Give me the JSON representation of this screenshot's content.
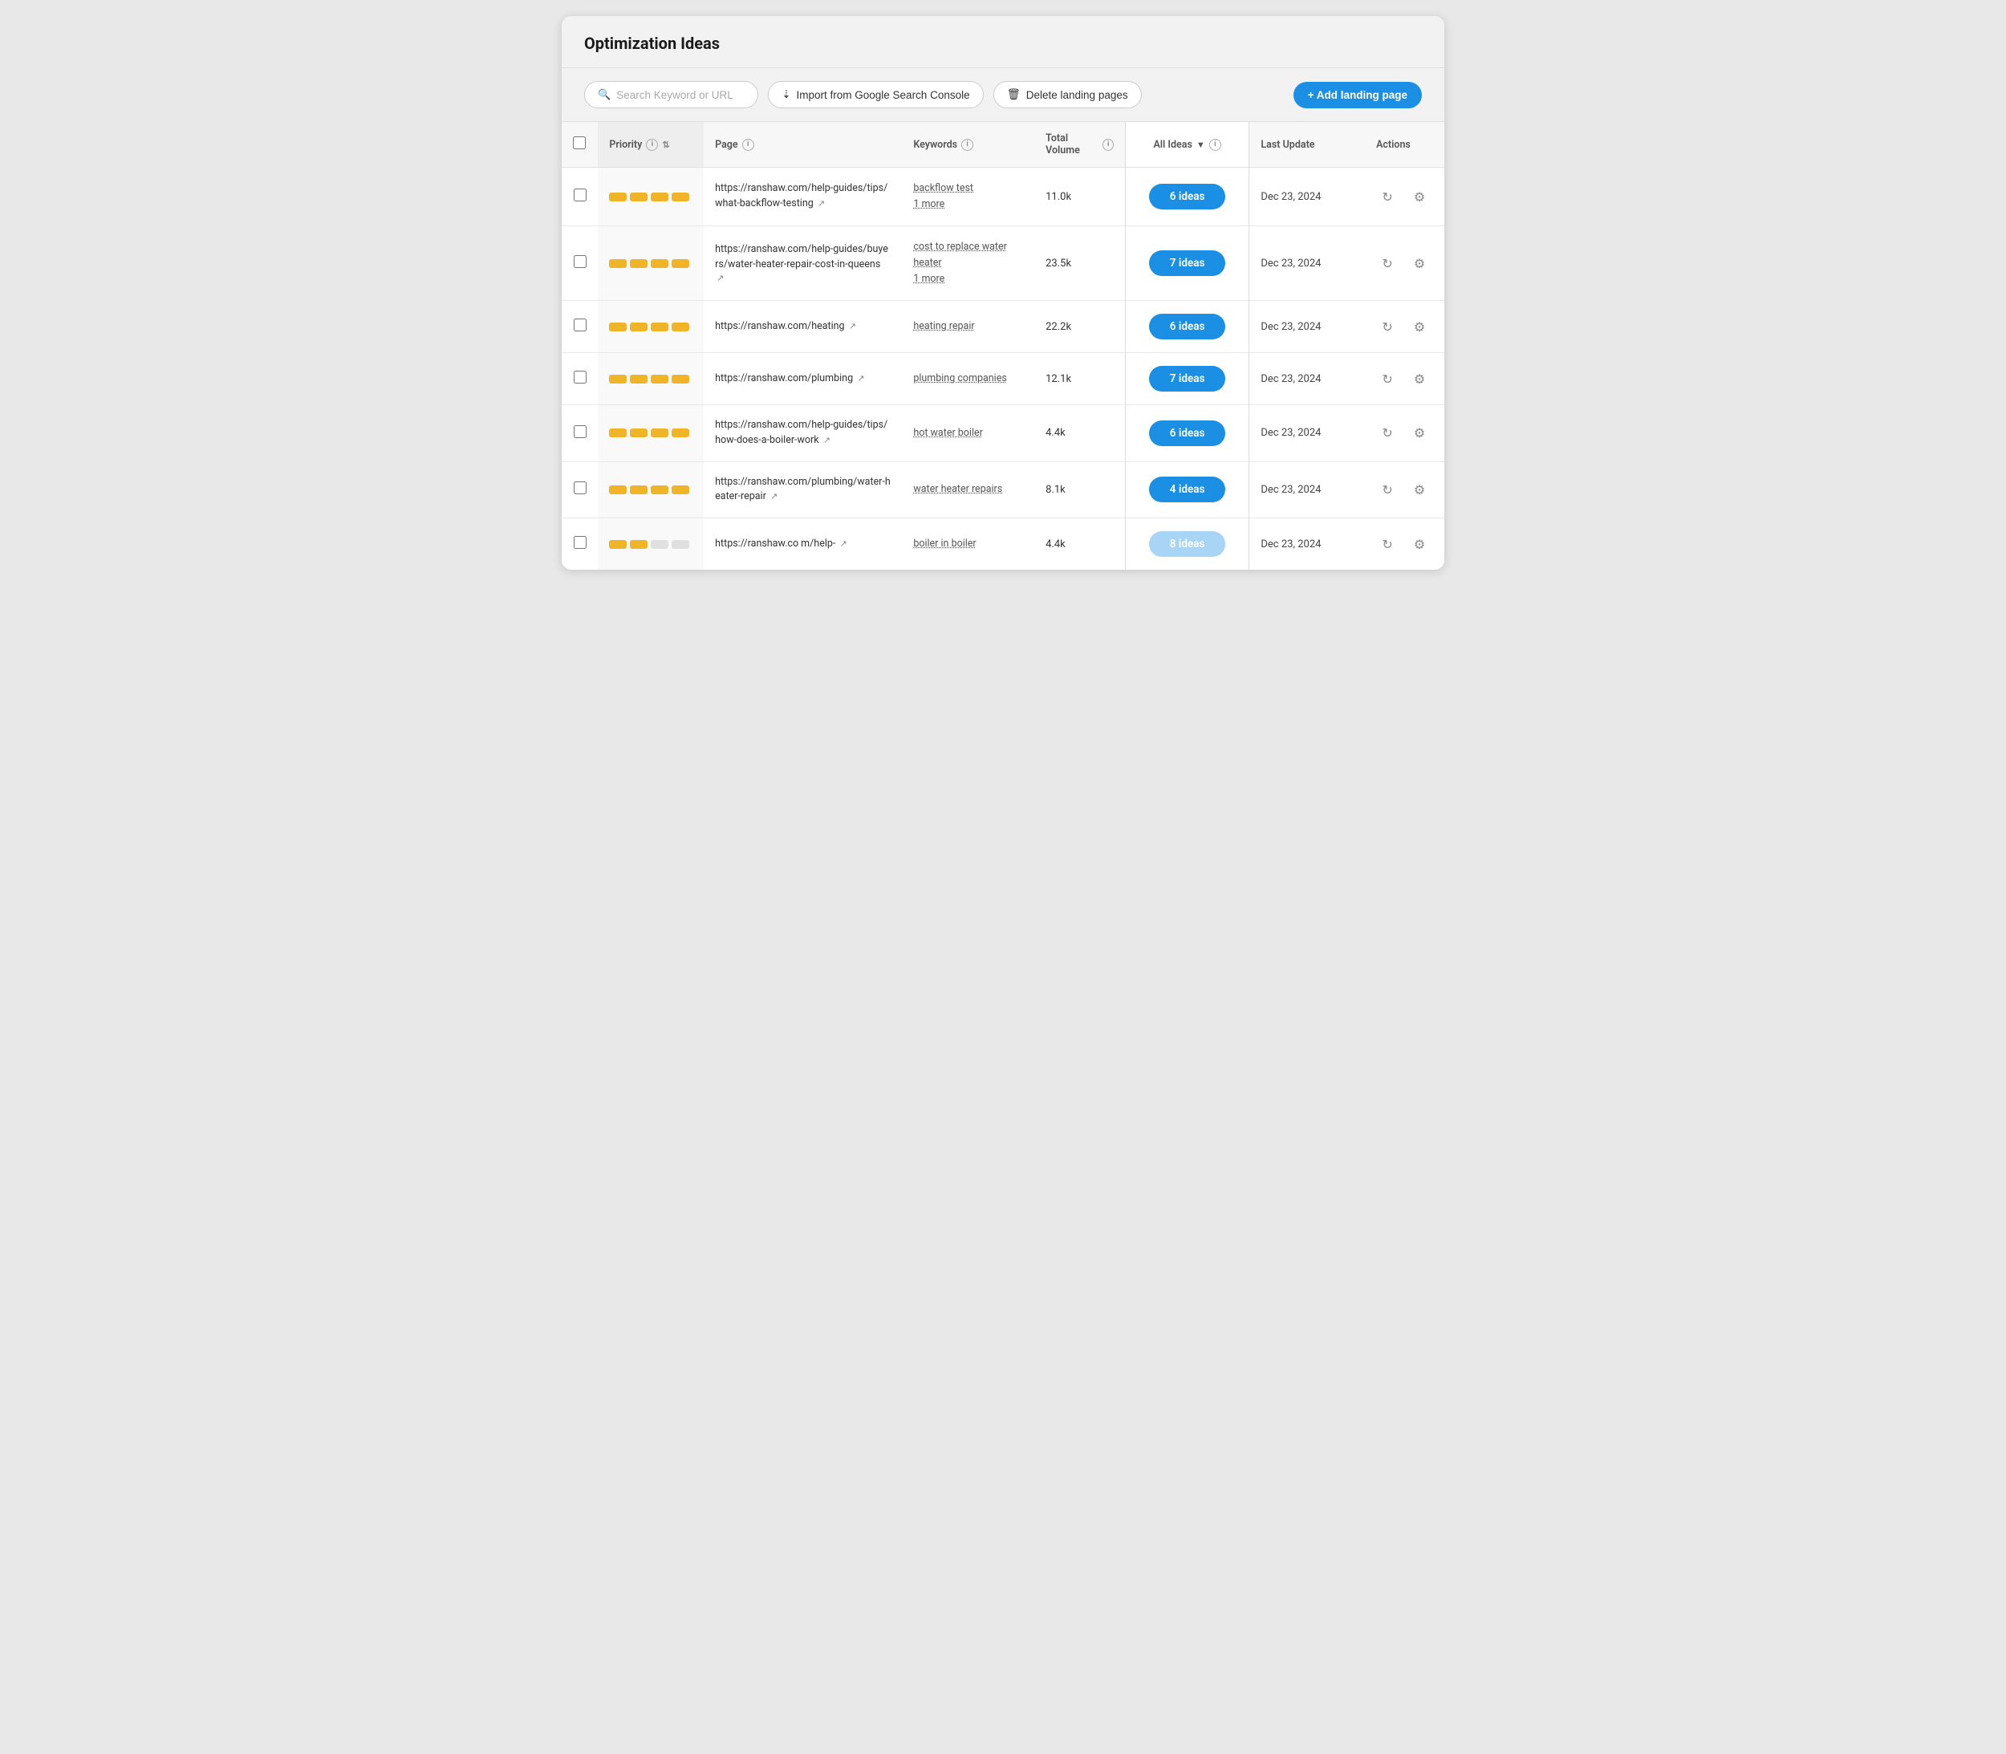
{
  "header": {
    "title": "Optimization Ideas"
  },
  "toolbar": {
    "search_placeholder": "Search Keyword or URL",
    "import_label": "Import from Google Search Console",
    "delete_label": "Delete landing pages",
    "add_label": "+ Add landing page"
  },
  "table": {
    "columns": {
      "priority": "Priority",
      "page": "Page",
      "keywords": "Keywords",
      "total_volume": "Total Volume",
      "all_ideas": "All Ideas",
      "last_update": "Last Update",
      "actions": "Actions"
    },
    "rows": [
      {
        "priority_bars": 4,
        "page_url": "https://ranshaw.com/help-guides/tips/what-backflow-testing",
        "keywords": [
          "backflow test",
          "1 more"
        ],
        "volume": "11.0k",
        "ideas": "6 ideas",
        "ideas_faded": false,
        "last_update": "Dec 23, 2024"
      },
      {
        "priority_bars": 4,
        "page_url": "https://ranshaw.com/help-guides/buyers/water-heater-repair-cost-in-queens",
        "keywords": [
          "cost to replace water heater",
          "1 more"
        ],
        "volume": "23.5k",
        "ideas": "7 ideas",
        "ideas_faded": false,
        "last_update": "Dec 23, 2024"
      },
      {
        "priority_bars": 4,
        "page_url": "https://ranshaw.com/heating",
        "keywords": [
          "heating repair"
        ],
        "volume": "22.2k",
        "ideas": "6 ideas",
        "ideas_faded": false,
        "last_update": "Dec 23, 2024"
      },
      {
        "priority_bars": 4,
        "page_url": "https://ranshaw.com/plumbing",
        "keywords": [
          "plumbing companies"
        ],
        "volume": "12.1k",
        "ideas": "7 ideas",
        "ideas_faded": false,
        "last_update": "Dec 23, 2024"
      },
      {
        "priority_bars": 4,
        "page_url": "https://ranshaw.com/help-guides/tips/how-does-a-boiler-work",
        "keywords": [
          "hot water boiler"
        ],
        "volume": "4.4k",
        "ideas": "6 ideas",
        "ideas_faded": false,
        "last_update": "Dec 23, 2024"
      },
      {
        "priority_bars": 4,
        "page_url": "https://ranshaw.com/plumbing/water-heater-repair",
        "keywords": [
          "water heater repairs"
        ],
        "volume": "8.1k",
        "ideas": "4 ideas",
        "ideas_faded": false,
        "last_update": "Dec 23, 2024"
      },
      {
        "priority_bars": 2,
        "page_url": "https://ranshaw.co m/help-",
        "keywords": [
          "boiler in boiler"
        ],
        "volume": "4.4k",
        "ideas": "8 ideas",
        "ideas_faded": true,
        "last_update": "Dec 23, 2024"
      }
    ]
  }
}
